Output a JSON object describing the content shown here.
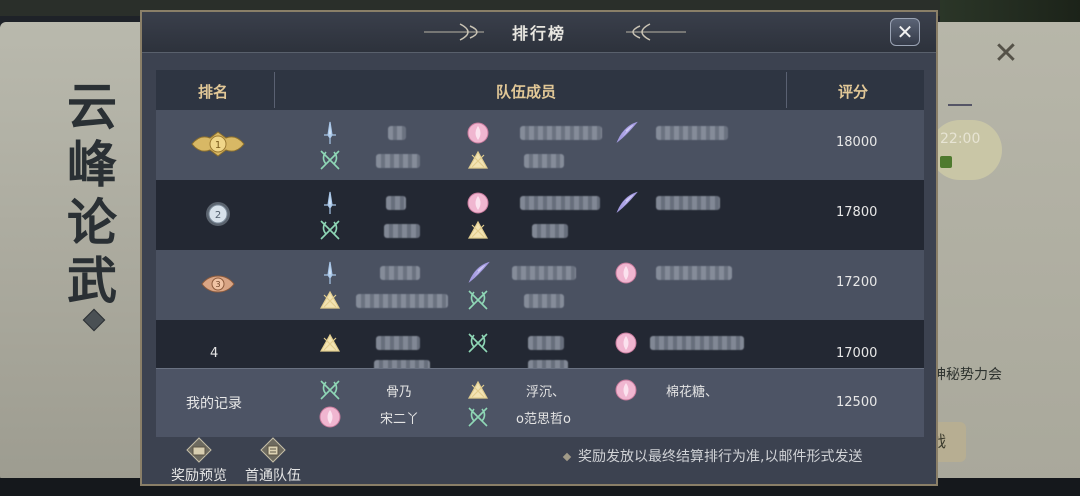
{
  "background": {
    "calligraphy": "云峰论武",
    "clock_time": "22:00",
    "right_text": "神秘势力会",
    "right_button": "战"
  },
  "panel": {
    "title": "排行榜",
    "close_icon": "close-x-icon"
  },
  "table": {
    "headers": {
      "rank": "排名",
      "members": "队伍成员",
      "score": "评分"
    },
    "rows": [
      {
        "rank": "1",
        "rank_style": "gold-medal",
        "score": "18000"
      },
      {
        "rank": "2",
        "rank_style": "silver-medal",
        "score": "17800"
      },
      {
        "rank": "3",
        "rank_style": "bronze-medal",
        "score": "17200"
      },
      {
        "rank": "4",
        "rank_style": "plain",
        "score": "17000"
      }
    ],
    "my_record": {
      "label": "我的记录",
      "score": "12500",
      "members": [
        {
          "name_top": "骨乃",
          "name_bottom": "宋二丫"
        },
        {
          "name_top": "浮沉、",
          "name_bottom": "ο范思哲ο"
        },
        {
          "name_top": "棉花糖、",
          "name_bottom": ""
        }
      ]
    }
  },
  "footer": {
    "reward_preview": "奖励预览",
    "first_clear_team": "首通队伍",
    "note": "奖励发放以最终结算排行为准,以邮件形式发送"
  },
  "colors": {
    "header_text": "#e2c897",
    "panel_bg": "#3c4250",
    "row_dark": "#232833",
    "row_light": "#4a5161"
  }
}
